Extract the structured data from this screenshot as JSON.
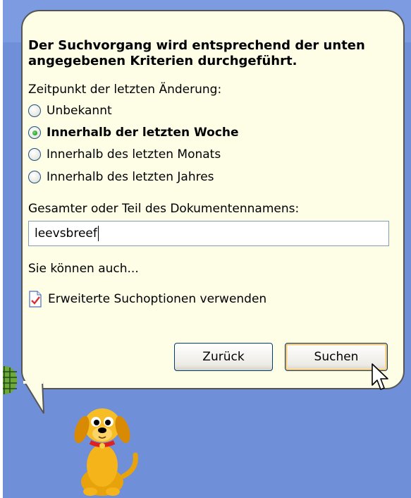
{
  "dialog": {
    "heading": "Der Suchvorgang wird entsprechend der unten angegebenen Kriterien durchgeführt.",
    "modified_label": "Zeitpunkt der letzten Änderung:",
    "options": [
      {
        "label": "Unbekannt",
        "checked": false
      },
      {
        "label": "Innerhalb der letzten Woche",
        "checked": true
      },
      {
        "label": "Innerhalb des letzten Monats",
        "checked": false
      },
      {
        "label": "Innerhalb des letzten Jahres",
        "checked": false
      }
    ],
    "name_label": "Gesamter oder Teil des Dokumentennamens:",
    "name_value": "leevsbreef",
    "also_label": "Sie können auch...",
    "advanced_link": "Erweiterte Suchoptionen verwenden",
    "back_button": "Zurück",
    "search_button": "Suchen"
  },
  "colors": {
    "background": "#6f8fd9",
    "bubble": "#fefee6",
    "selected_radio": "#21a121"
  },
  "icons": [
    "document-options-icon",
    "search-dog-icon",
    "globe-icon",
    "mouse-cursor-icon"
  ]
}
